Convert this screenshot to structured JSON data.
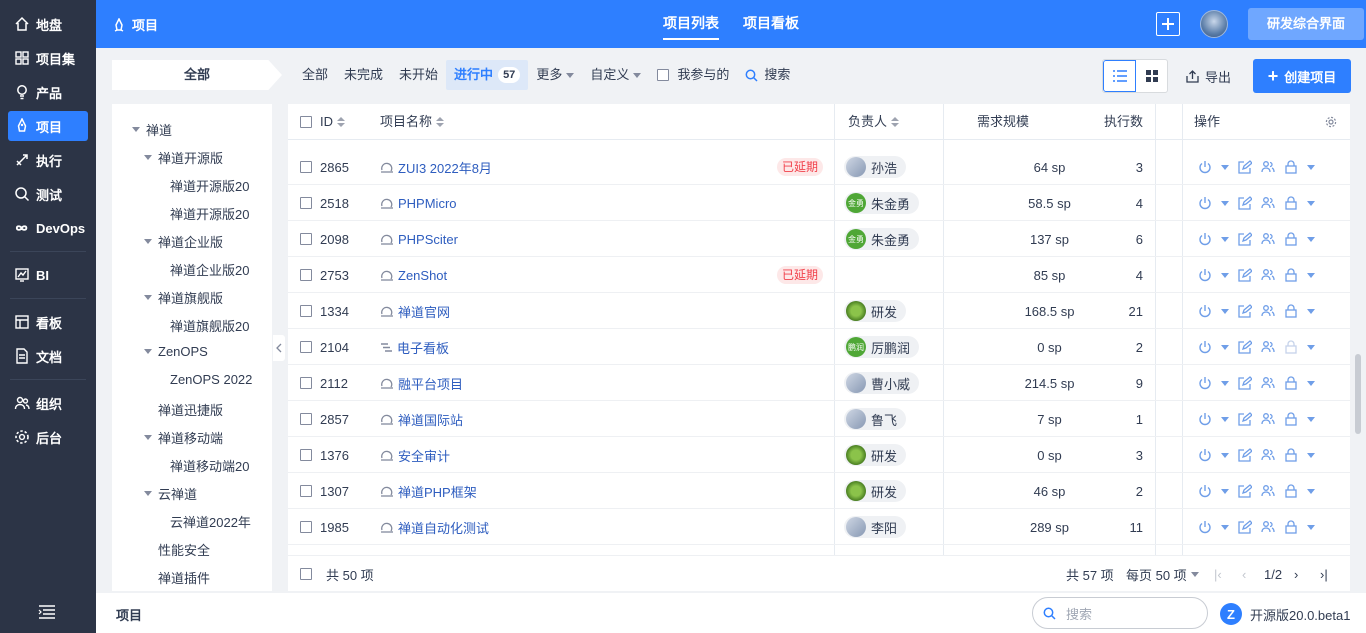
{
  "nav": {
    "items": [
      {
        "label": "地盘",
        "icon": "home-icon"
      },
      {
        "label": "项目集",
        "icon": "grid-icon"
      },
      {
        "label": "产品",
        "icon": "bulb-icon"
      },
      {
        "label": "项目",
        "icon": "rocket-icon",
        "active": true
      },
      {
        "label": "执行",
        "icon": "rocket-launch-icon"
      },
      {
        "label": "测试",
        "icon": "bug-search-icon"
      },
      {
        "label": "DevOps",
        "icon": "infinity-icon"
      },
      {
        "label": "BI",
        "icon": "chart-icon"
      },
      {
        "label": "看板",
        "icon": "kanban-icon"
      },
      {
        "label": "文档",
        "icon": "doc-icon"
      },
      {
        "label": "组织",
        "icon": "people-icon"
      },
      {
        "label": "后台",
        "icon": "settings-icon"
      }
    ]
  },
  "header": {
    "breadcrumb": "项目",
    "tabs": [
      "项目列表",
      "项目看板"
    ],
    "active_tab": "项目列表",
    "dev_button": "研发综合界面",
    "accent": "#2e7fff"
  },
  "toolbar": {
    "all_pill": "全部",
    "filters": [
      {
        "label": "全部"
      },
      {
        "label": "未完成"
      },
      {
        "label": "未开始"
      },
      {
        "label": "进行中",
        "count": "57",
        "active": true
      },
      {
        "label": "更多",
        "dropdown": true
      },
      {
        "label": "自定义",
        "dropdown": true
      }
    ],
    "mine_label": "我参与的",
    "search_label": "搜索",
    "export_label": "导出",
    "create_label": "创建项目"
  },
  "tree": {
    "nodes": [
      {
        "label": "禅道",
        "level": 0,
        "expand": true
      },
      {
        "label": "禅道开源版",
        "level": 1,
        "expand": true
      },
      {
        "label": "禅道开源版20",
        "level": 2
      },
      {
        "label": "禅道开源版20",
        "level": 2
      },
      {
        "label": "禅道企业版",
        "level": 1,
        "expand": true
      },
      {
        "label": "禅道企业版20",
        "level": 2
      },
      {
        "label": "禅道旗舰版",
        "level": 1,
        "expand": true
      },
      {
        "label": "禅道旗舰版20",
        "level": 2
      },
      {
        "label": "ZenOPS",
        "level": 1,
        "expand": true
      },
      {
        "label": "ZenOPS 2022",
        "level": 2
      },
      {
        "label": "禅道迅捷版",
        "level": 1
      },
      {
        "label": "禅道移动端",
        "level": 1,
        "expand": true
      },
      {
        "label": "禅道移动端20",
        "level": 2
      },
      {
        "label": "云禅道",
        "level": 1,
        "expand": true
      },
      {
        "label": "云禅道2022年",
        "level": 2
      },
      {
        "label": "性能安全",
        "level": 1
      },
      {
        "label": "禅道插件",
        "level": 1
      }
    ]
  },
  "table": {
    "columns": {
      "id": "ID",
      "name": "项目名称",
      "owner": "负责人",
      "scale": "需求规模",
      "exec": "执行数",
      "actions": "操作"
    },
    "rows": [
      {
        "id": "2865",
        "name": "ZUI3 2022年8月",
        "delayed": "已延期",
        "owner": "孙浩",
        "av": "img",
        "scale": "64 sp",
        "exec": "3",
        "icon": "sprint-icon"
      },
      {
        "id": "2518",
        "name": "PHPMicro",
        "delayed": "",
        "owner": "朱金勇",
        "av": "green",
        "avtext": "金勇",
        "scale": "58.5 sp",
        "exec": "4",
        "icon": "sprint-icon"
      },
      {
        "id": "2098",
        "name": "PHPSciter",
        "delayed": "",
        "owner": "朱金勇",
        "av": "green",
        "avtext": "金勇",
        "scale": "137 sp",
        "exec": "6",
        "icon": "sprint-icon"
      },
      {
        "id": "2753",
        "name": "ZenShot",
        "delayed": "已延期",
        "owner": "",
        "av": "",
        "scale": "85 sp",
        "exec": "4",
        "icon": "sprint-icon"
      },
      {
        "id": "1334",
        "name": "禅道官网",
        "delayed": "",
        "owner": "研发",
        "av": "robot",
        "scale": "168.5 sp",
        "exec": "21",
        "icon": "sprint-icon"
      },
      {
        "id": "2104",
        "name": "电子看板",
        "delayed": "",
        "owner": "厉鹏润",
        "av": "green",
        "avtext": "鹏润",
        "scale": "0 sp",
        "exec": "2",
        "icon": "waterfall-icon",
        "lockDisabled": true
      },
      {
        "id": "2112",
        "name": "融平台项目",
        "delayed": "",
        "owner": "曹小威",
        "av": "img",
        "scale": "214.5 sp",
        "exec": "9",
        "icon": "sprint-icon"
      },
      {
        "id": "2857",
        "name": "禅道国际站",
        "delayed": "",
        "owner": "鲁飞",
        "av": "img",
        "scale": "7 sp",
        "exec": "1",
        "icon": "sprint-icon"
      },
      {
        "id": "1376",
        "name": "安全审计",
        "delayed": "",
        "owner": "研发",
        "av": "robot",
        "scale": "0 sp",
        "exec": "3",
        "icon": "sprint-icon"
      },
      {
        "id": "1307",
        "name": "禅道PHP框架",
        "delayed": "",
        "owner": "研发",
        "av": "robot",
        "scale": "46 sp",
        "exec": "2",
        "icon": "sprint-icon"
      },
      {
        "id": "1985",
        "name": "禅道自动化测试",
        "delayed": "",
        "owner": "李阳",
        "av": "img",
        "scale": "289 sp",
        "exec": "11",
        "icon": "sprint-icon"
      }
    ],
    "footer_selected": "共 50 项",
    "footer_total": "共 57 项",
    "footer_per_page": "每页 50 项",
    "footer_page": "1/2"
  },
  "bottom": {
    "label": "项目",
    "search_placeholder": "搜索",
    "version": "开源版20.0.beta1"
  }
}
